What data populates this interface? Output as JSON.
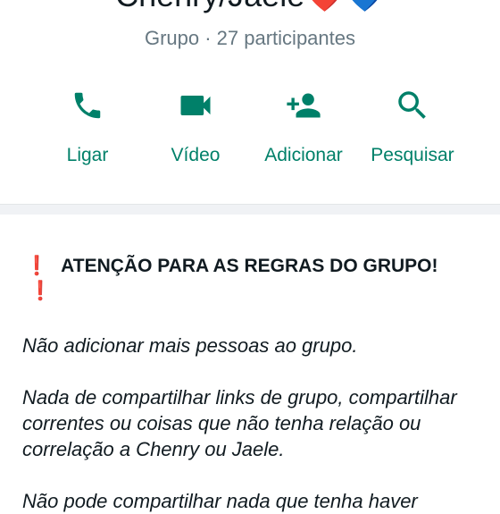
{
  "group": {
    "title": "Chenry/Jaele❤️💙",
    "subtitle": "Grupo · 27 participantes"
  },
  "actions": [
    {
      "label": "Ligar",
      "icon": "phone-icon"
    },
    {
      "label": "Vídeo",
      "icon": "video-icon"
    },
    {
      "label": "Adicionar",
      "icon": "add-person-icon"
    },
    {
      "label": "Pesquisar",
      "icon": "search-icon"
    }
  ],
  "description": {
    "exclaim": "❗",
    "heading": "ATENÇÃO PARA AS REGRAS DO GRUPO!",
    "exclaim_trailing": "❗",
    "paragraphs": [
      "Não adicionar mais pessoas ao grupo.",
      "Nada de compartilhar links de grupo, compartilhar correntes ou coisas que não tenha relação ou correlação a Chenry ou Jaele.",
      "Não pode compartilhar nada que tenha haver"
    ]
  },
  "colors": {
    "accent": "#008069",
    "alert": "#e02b2b",
    "secondary_text": "#667781"
  }
}
